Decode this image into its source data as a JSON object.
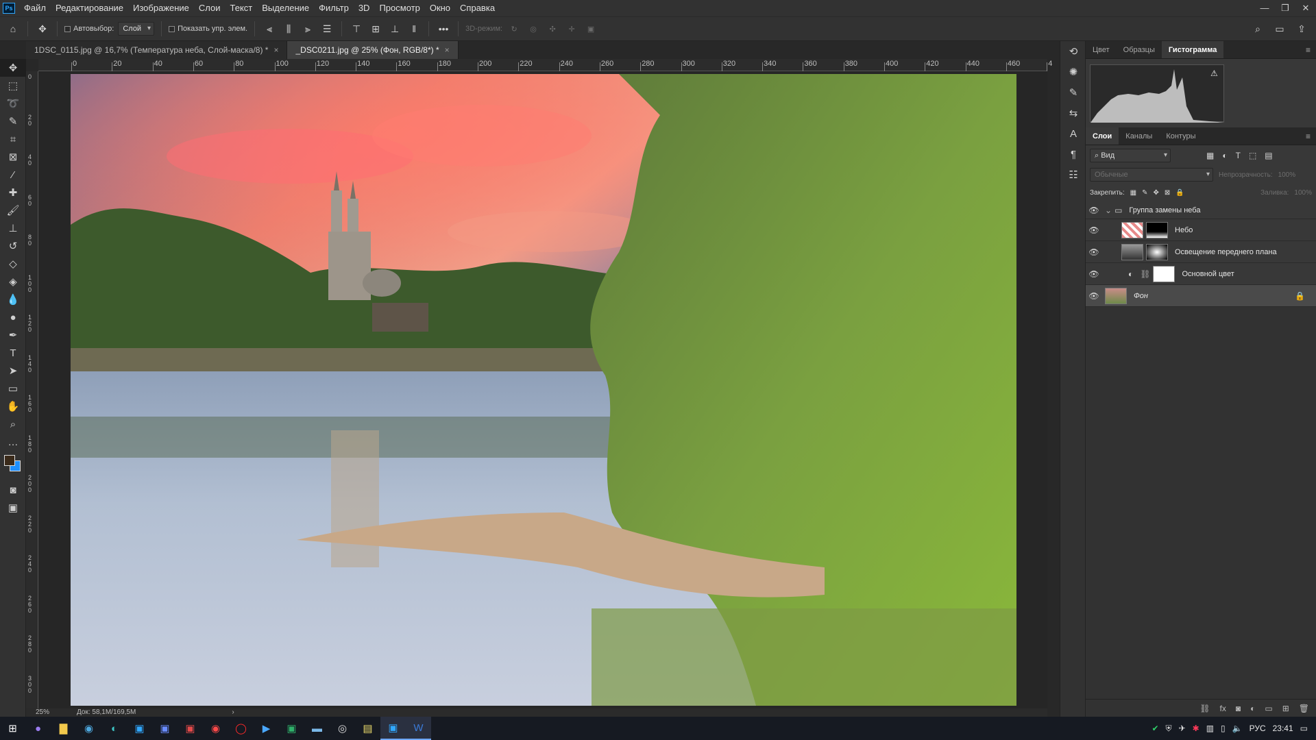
{
  "menubar": {
    "logo": "Ps",
    "items": [
      "Файл",
      "Редактирование",
      "Изображение",
      "Слои",
      "Текст",
      "Выделение",
      "Фильтр",
      "3D",
      "Просмотр",
      "Окно",
      "Справка"
    ],
    "window_controls": [
      "—",
      "❐",
      "✕"
    ]
  },
  "options": {
    "autoselect_label": "Автовыбор:",
    "autoselect_value": "Слой",
    "show_transform_label": "Показать упр. элем.",
    "mode_3d": "3D-режим:",
    "more": "•••"
  },
  "tabs": [
    {
      "label": "1DSC_0115.jpg @ 16,7% (Температура неба, Слой-маска/8) *",
      "active": false
    },
    {
      "label": "_DSC0211.jpg @ 25% (Фон, RGB/8*) *",
      "active": true
    }
  ],
  "ruler": {
    "top": [
      "0",
      "20",
      "40",
      "60",
      "80",
      "100",
      "120",
      "140",
      "160",
      "180",
      "200",
      "220",
      "240",
      "260",
      "280",
      "300",
      "320",
      "340",
      "360",
      "380",
      "400",
      "420",
      "440",
      "460",
      "4"
    ],
    "left": [
      "0",
      "20",
      "40",
      "60",
      "80",
      "100",
      "120",
      "140",
      "160",
      "180",
      "200",
      "220",
      "240",
      "260",
      "280",
      "300"
    ]
  },
  "status": {
    "zoom": "25%",
    "doc": "Док: 58,1M/169,5M",
    "arrow": "›"
  },
  "panels": {
    "top_tabs": [
      "Цвет",
      "Образцы",
      "Гистограмма"
    ],
    "top_active": 2,
    "layer_tabs": [
      "Слои",
      "Каналы",
      "Контуры"
    ],
    "layer_active": 0,
    "filter_label": "Вид",
    "blend_mode": "Обычные",
    "opacity_label": "Непрозрачность:",
    "opacity_value": "100%",
    "lock_label": "Закрепить:",
    "fill_label": "Заливка:",
    "fill_value": "100%",
    "group_name": "Группа замены неба",
    "layers": [
      {
        "name": "Небо",
        "thumb": "sky",
        "mask": "black-top"
      },
      {
        "name": "Освещение переднего плана",
        "thumb": "gray",
        "mask": "gradient"
      },
      {
        "name": "Основной цвет",
        "thumb": "adjust",
        "mask": "white"
      },
      {
        "name": "Фон",
        "thumb": "photo",
        "mask": "none"
      }
    ]
  },
  "taskbar": {
    "lang": "РУС",
    "time": "23:41"
  },
  "colors": {
    "accent": "#31a8ff",
    "foreground": "#3a2a1a",
    "background": "#1e90ff"
  }
}
